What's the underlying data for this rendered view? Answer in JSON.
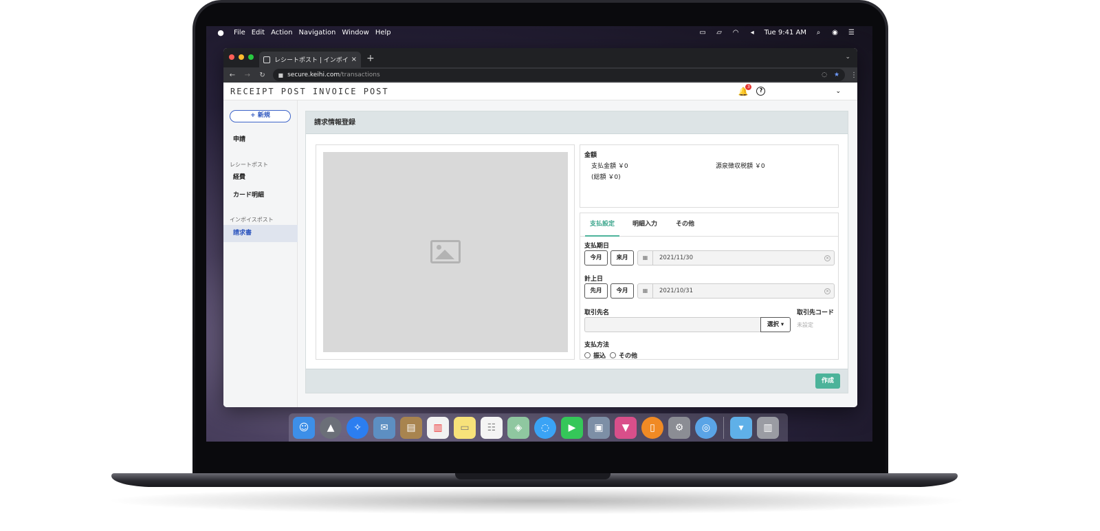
{
  "menubar": {
    "items": [
      "File",
      "Edit",
      "Action",
      "Navigation",
      "Window",
      "Help"
    ],
    "clock": "Tue 9:41 AM"
  },
  "browser": {
    "tab_title": "レシートポスト | インボイスポスト",
    "url_host": "secure.keihi.com",
    "url_path": "/transactions"
  },
  "app": {
    "logo": "RECEIPT POST  INVOICE POST",
    "notification_count": "3",
    "help_symbol": "?"
  },
  "sidebar": {
    "new_button": "+ 新規",
    "apply": "申請",
    "receipt_section": "レシートポスト",
    "expenses": "経費",
    "card_details": "カード明細",
    "invoice_section": "インボイスポスト",
    "invoices": "請求書"
  },
  "panel": {
    "title": "請求情報登録",
    "create_button": "作成"
  },
  "amount": {
    "label": "金額",
    "payment": "支払金額 ￥0",
    "withholding": "源泉徴収税額 ￥0",
    "total": "(総額 ￥0)"
  },
  "form": {
    "tabs": [
      "支払設定",
      "明細入力",
      "その他"
    ],
    "due_date_label": "支払期日",
    "due_btn_this": "今月",
    "due_btn_next": "来月",
    "due_date_value": "2021/11/30",
    "booking_label": "計上日",
    "booking_btn_prev": "先月",
    "booking_btn_this": "今月",
    "booking_date_value": "2021/10/31",
    "vendor_label": "取引先名",
    "select_button": "選択 ▾",
    "vendor_code_label": "取引先コード",
    "vendor_code_value": "未設定",
    "payment_method_label": "支払方法",
    "method_transfer": "振込",
    "method_other": "その他"
  },
  "colors": {
    "accent_green": "#4cb39a",
    "accent_blue": "#2f57bf"
  }
}
